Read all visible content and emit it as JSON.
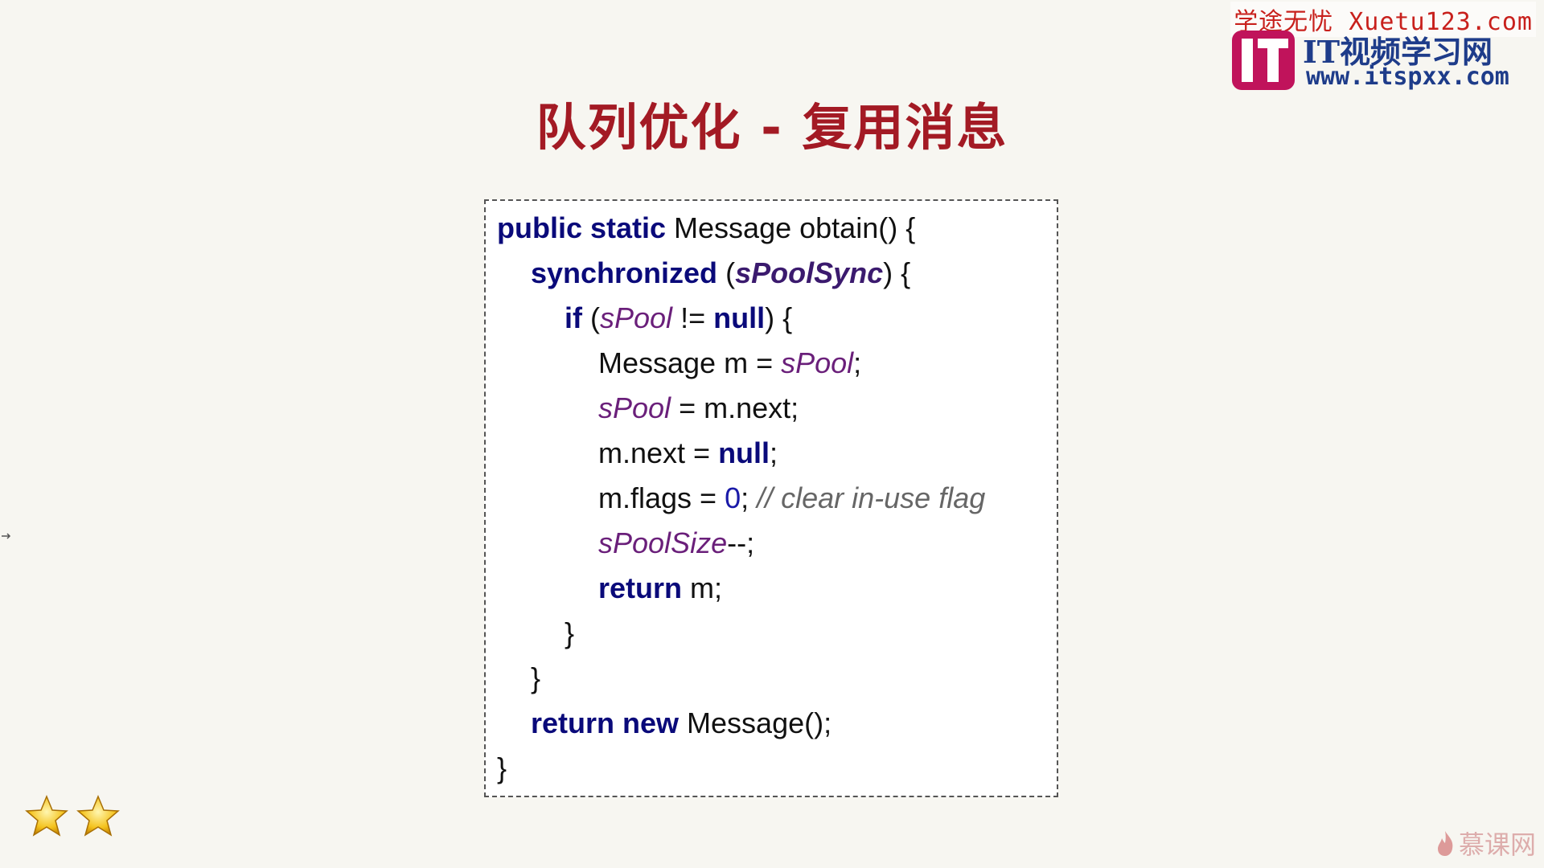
{
  "watermark": {
    "line1": "学途无忧 Xuetu123.com",
    "logo_letters": "IT",
    "site_name": "IT视频学习网",
    "site_url": "www.itspxx.com",
    "bottom_brand": "慕课网",
    "accent_red": "#c8201c",
    "accent_blue": "#1e3c8a",
    "logo_magenta": "#c0135b"
  },
  "slide": {
    "title": "队列优化 - 复用消息",
    "title_color": "#a31a24",
    "difficulty_stars": 2
  },
  "code": {
    "l1_kw": "public static",
    "l1_rest": " Message obtain() {",
    "l2_kw": "synchronized",
    "l2_open": " (",
    "l2_field": "sPoolSync",
    "l2_close": ") {",
    "l3_kw": "if",
    "l3_open": " (",
    "l3_field": "sPool",
    "l3_mid": " != ",
    "l3_kw2": "null",
    "l3_close": ") {",
    "l4_text": "Message m = ",
    "l4_field": "sPool",
    "l4_end": ";",
    "l5_field": "sPool",
    "l5_text": " = m.next;",
    "l6_text": "m.next = ",
    "l6_kw": "null",
    "l6_end": ";",
    "l7_text": "m.flags = ",
    "l7_num": "0",
    "l7_semi": "; ",
    "l7_comment": "// clear in-use flag",
    "l8_field": "sPoolSize",
    "l8_text": "--;",
    "l9_kw": "return",
    "l9_text": " m;",
    "l10_text": "}",
    "l11_text": "}",
    "l12_kw": "return new",
    "l12_text": " Message();",
    "l13_text": "}"
  }
}
